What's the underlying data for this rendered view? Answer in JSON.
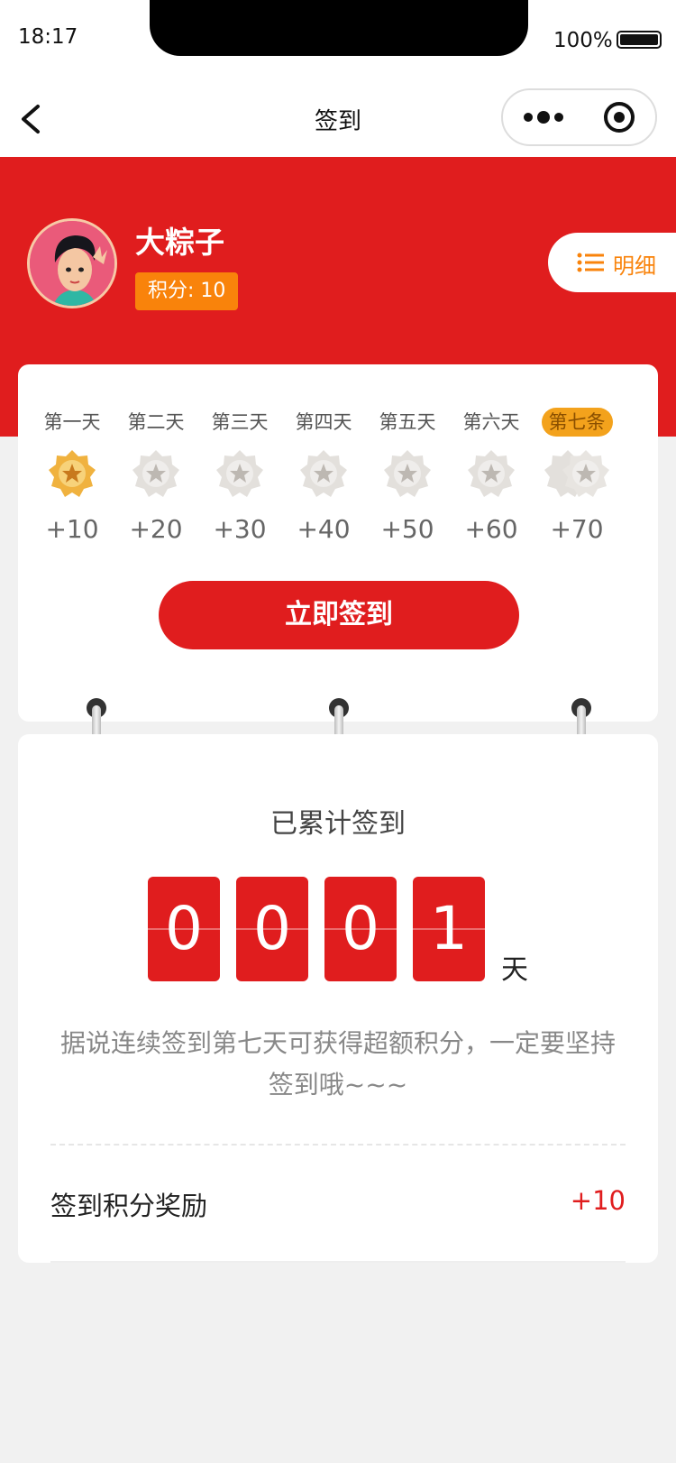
{
  "status_bar": {
    "time": "18:17",
    "battery": "100%"
  },
  "nav": {
    "title": "签到"
  },
  "user": {
    "name": "大粽子",
    "points_label": "积分: 10",
    "detail_label": "明细"
  },
  "days": [
    {
      "label": "第一天",
      "points": "+10",
      "checked": true
    },
    {
      "label": "第二天",
      "points": "+20",
      "checked": false
    },
    {
      "label": "第三天",
      "points": "+30",
      "checked": false
    },
    {
      "label": "第四天",
      "points": "+40",
      "checked": false
    },
    {
      "label": "第五天",
      "points": "+50",
      "checked": false
    },
    {
      "label": "第六天",
      "points": "+60",
      "checked": false
    },
    {
      "label": "第七条",
      "points": "+70",
      "checked": false,
      "highlight": true
    }
  ],
  "checkin_button": "立即签到",
  "cumulative": {
    "title": "已累计签到",
    "digits": [
      "0",
      "0",
      "0",
      "1"
    ],
    "unit": "天",
    "tip": "据说连续签到第七天可获得超额积分，一定要坚持签到哦~~~"
  },
  "reward": {
    "label": "签到积分奖励",
    "value": "+10"
  },
  "colors": {
    "primary_red": "#e01d1e",
    "orange": "#f9830b",
    "gold": "#f3a21c"
  }
}
